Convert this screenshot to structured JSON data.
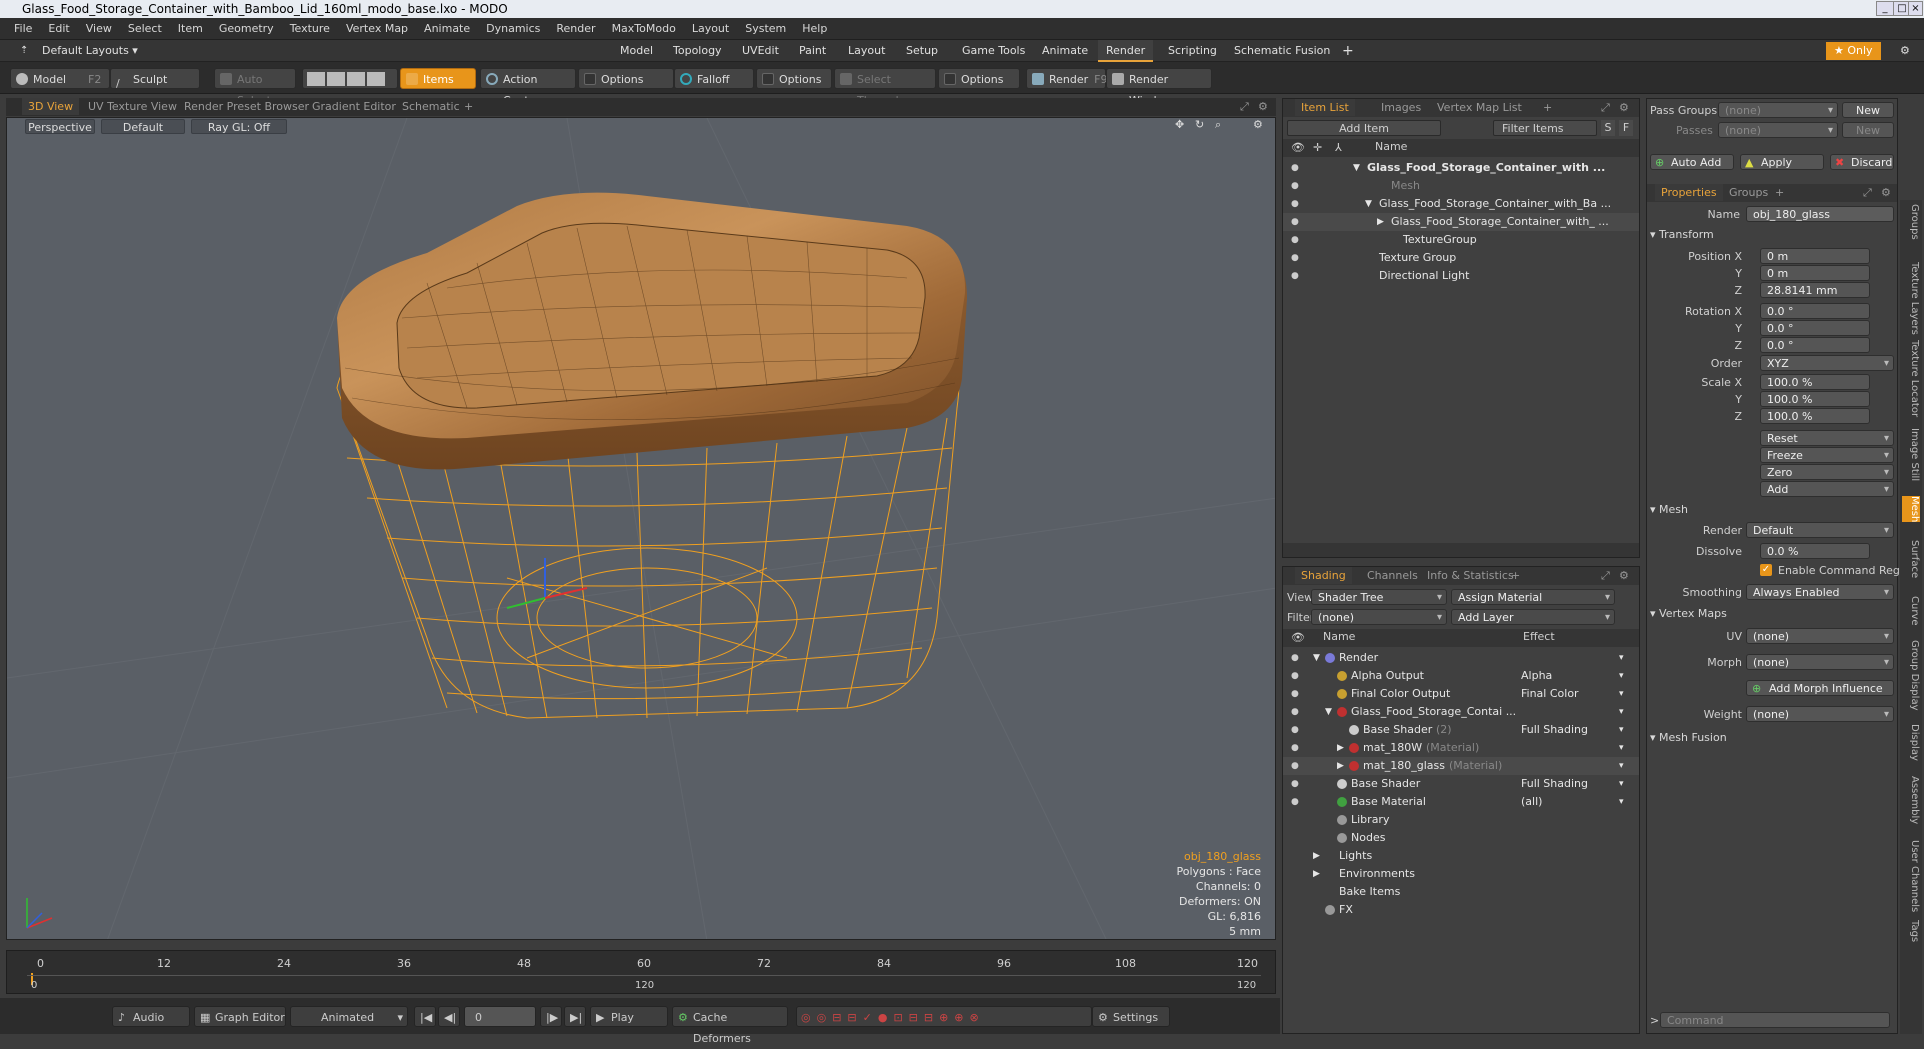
{
  "window": {
    "title": "Glass_Food_Storage_Container_with_Bamboo_Lid_160ml_modo_base.lxo - MODO"
  },
  "menu": [
    "File",
    "Edit",
    "View",
    "Select",
    "Item",
    "Geometry",
    "Texture",
    "Vertex Map",
    "Animate",
    "Dynamics",
    "Render",
    "MaxToModo",
    "Layout",
    "System",
    "Help"
  ],
  "layouts": {
    "current": "Default Layouts ▾",
    "tabs": [
      "Model",
      "Topology",
      "UVEdit",
      "Paint",
      "Layout",
      "Setup",
      "Game Tools",
      "Animate",
      "Render",
      "Scripting",
      "Schematic Fusion",
      "+"
    ],
    "active": "Render",
    "only": "★ Only"
  },
  "toolbar": {
    "model": "Model",
    "model_key": "F2",
    "sculpt": "Sculpt",
    "auto_select": "Auto Select",
    "items": "Items",
    "action_center": "Action Center",
    "options1": "Options",
    "falloff": "Falloff",
    "options2": "Options",
    "select_through": "Select Through",
    "options3": "Options",
    "render": "Render",
    "render_key": "F9",
    "render_window": "Render Window"
  },
  "viewtabs": [
    "3D View",
    "UV Texture View",
    "Render Preset Browser",
    "Gradient Editor",
    "Schematic",
    "+"
  ],
  "viewport": {
    "perspective": "Perspective",
    "default": "Default",
    "raygl": "Ray GL: Off",
    "info": {
      "item": "obj_180_glass",
      "polygons": "Polygons : Face",
      "channels": "Channels: 0",
      "deformers": "Deformers: ON",
      "gl": "GL: 6,816",
      "size": "5 mm"
    }
  },
  "timeline": {
    "ticks": [
      "0",
      "12",
      "24",
      "36",
      "48",
      "60",
      "72",
      "84",
      "96",
      "108",
      "120"
    ],
    "start": "0",
    "end": "120",
    "end2": "120"
  },
  "bottom": {
    "audio": "Audio",
    "graph_editor": "Graph Editor",
    "animated": "Animated",
    "frame": "0",
    "play": "Play",
    "cache": "Cache Deformers",
    "settings": "Settings"
  },
  "itemlist": {
    "tabs": [
      "Item List",
      "Images",
      "Vertex Map List",
      "+"
    ],
    "add_item": "Add Item",
    "filter": "Filter Items",
    "s": "S",
    "f": "F",
    "col_name": "Name",
    "rows": [
      {
        "label": "Glass_Food_Storage_Container_with ...",
        "indent": 0,
        "bold": true,
        "arrow": "▼"
      },
      {
        "label": "Mesh",
        "indent": 2,
        "dim": true,
        "arrow": ""
      },
      {
        "label": "Glass_Food_Storage_Container_with_Ba ...",
        "indent": 1,
        "arrow": "▼"
      },
      {
        "label": "Glass_Food_Storage_Container_with_ ...",
        "indent": 2,
        "arrow": "▶"
      },
      {
        "label": "TextureGroup",
        "indent": 3,
        "arrow": ""
      },
      {
        "label": "Texture Group",
        "indent": 1,
        "arrow": ""
      },
      {
        "label": "Directional Light",
        "indent": 1,
        "arrow": ""
      }
    ]
  },
  "shading": {
    "tabs": [
      "Shading",
      "Channels",
      "Info & Statistics",
      "+"
    ],
    "view_label": "View",
    "view_value": "Shader Tree",
    "assign": "Assign Material",
    "filter_label": "Filter",
    "filter_value": "(none)",
    "add_layer": "Add Layer",
    "col_name": "Name",
    "col_effect": "Effect",
    "rows": [
      {
        "label": "Render",
        "effect": "",
        "indent": 0,
        "arrow": "▼",
        "color": "#7a7ad8"
      },
      {
        "label": "Alpha Output",
        "effect": "Alpha",
        "indent": 1,
        "color": "#c8a030"
      },
      {
        "label": "Final Color Output",
        "effect": "Final Color",
        "indent": 1,
        "color": "#c8a030"
      },
      {
        "label": "Glass_Food_Storage_Contai ...",
        "effect": "",
        "indent": 1,
        "arrow": "▼",
        "color": "#c03030"
      },
      {
        "label": "Base Shader",
        "sub": "(2)",
        "effect": "Full Shading",
        "indent": 2,
        "color": "#cccccc"
      },
      {
        "label": "mat_180W",
        "sub": "(Material)",
        "effect": "",
        "indent": 2,
        "arrow": "▶",
        "color": "#c03030"
      },
      {
        "label": "mat_180_glass",
        "sub": "(Material)",
        "effect": "",
        "indent": 2,
        "arrow": "▶",
        "color": "#c03030"
      },
      {
        "label": "Base Shader",
        "effect": "Full Shading",
        "indent": 1,
        "color": "#cccccc"
      },
      {
        "label": "Base Material",
        "effect": "(all)",
        "indent": 1,
        "color": "#40a040"
      },
      {
        "label": "Library",
        "effect": "",
        "indent": 1,
        "color": "#999"
      },
      {
        "label": "Nodes",
        "effect": "",
        "indent": 1,
        "color": "#999"
      },
      {
        "label": "Lights",
        "effect": "",
        "indent": 0,
        "arrow": "▶",
        "color": ""
      },
      {
        "label": "Environments",
        "effect": "",
        "indent": 0,
        "arrow": "▶",
        "color": ""
      },
      {
        "label": "Bake Items",
        "effect": "",
        "indent": 0,
        "color": ""
      },
      {
        "label": "FX",
        "effect": "",
        "indent": 0,
        "color": "#999"
      }
    ]
  },
  "props": {
    "pass_groups": "Pass Groups",
    "pass_groups_val": "(none)",
    "new": "New",
    "passes": "Passes",
    "passes_val": "(none)",
    "new2": "New",
    "auto_add": "Auto Add",
    "apply": "Apply",
    "discard": "Discard",
    "tabs": [
      "Properties",
      "Groups",
      "+"
    ],
    "name_label": "Name",
    "name_value": "obj_180_glass",
    "transform": "Transform",
    "pos_label": "Position X",
    "px": "0 m",
    "py": "0 m",
    "pz": "28.8141 mm",
    "rot_label": "Rotation X",
    "rx": "0.0 °",
    "ry": "0.0 °",
    "rz": "0.0 °",
    "order_label": "Order",
    "order": "XYZ",
    "scale_label": "Scale X",
    "sx": "100.0 %",
    "sy": "100.0 %",
    "sz": "100.0 %",
    "y": "Y",
    "z": "Z",
    "reset": "Reset",
    "freeze": "Freeze",
    "zero": "Zero",
    "add": "Add",
    "mesh": "Mesh",
    "render_label": "Render",
    "render_val": "Default",
    "dissolve_label": "Dissolve",
    "dissolve_val": "0.0 %",
    "enable_cmd": "Enable Command Reg...",
    "smoothing_label": "Smoothing",
    "smoothing_val": "Always Enabled",
    "vertex_maps": "Vertex Maps",
    "uv_label": "UV",
    "uv_val": "(none)",
    "morph_label": "Morph",
    "morph_val": "(none)",
    "add_morph": "Add Morph Influence",
    "weight_label": "Weight",
    "weight_val": "(none)",
    "mesh_fusion": "Mesh Fusion",
    "command": "Command"
  },
  "sidetabs": [
    "Groups",
    "Texture Layers",
    "Texture Locator",
    "Image Still",
    "Mesh",
    "Surface",
    "Curve",
    "Group Display",
    "Display",
    "Assembly",
    "User Channels",
    "Tags"
  ],
  "colors": {
    "accent": "#e8a33a",
    "wire": "#f0a020"
  }
}
